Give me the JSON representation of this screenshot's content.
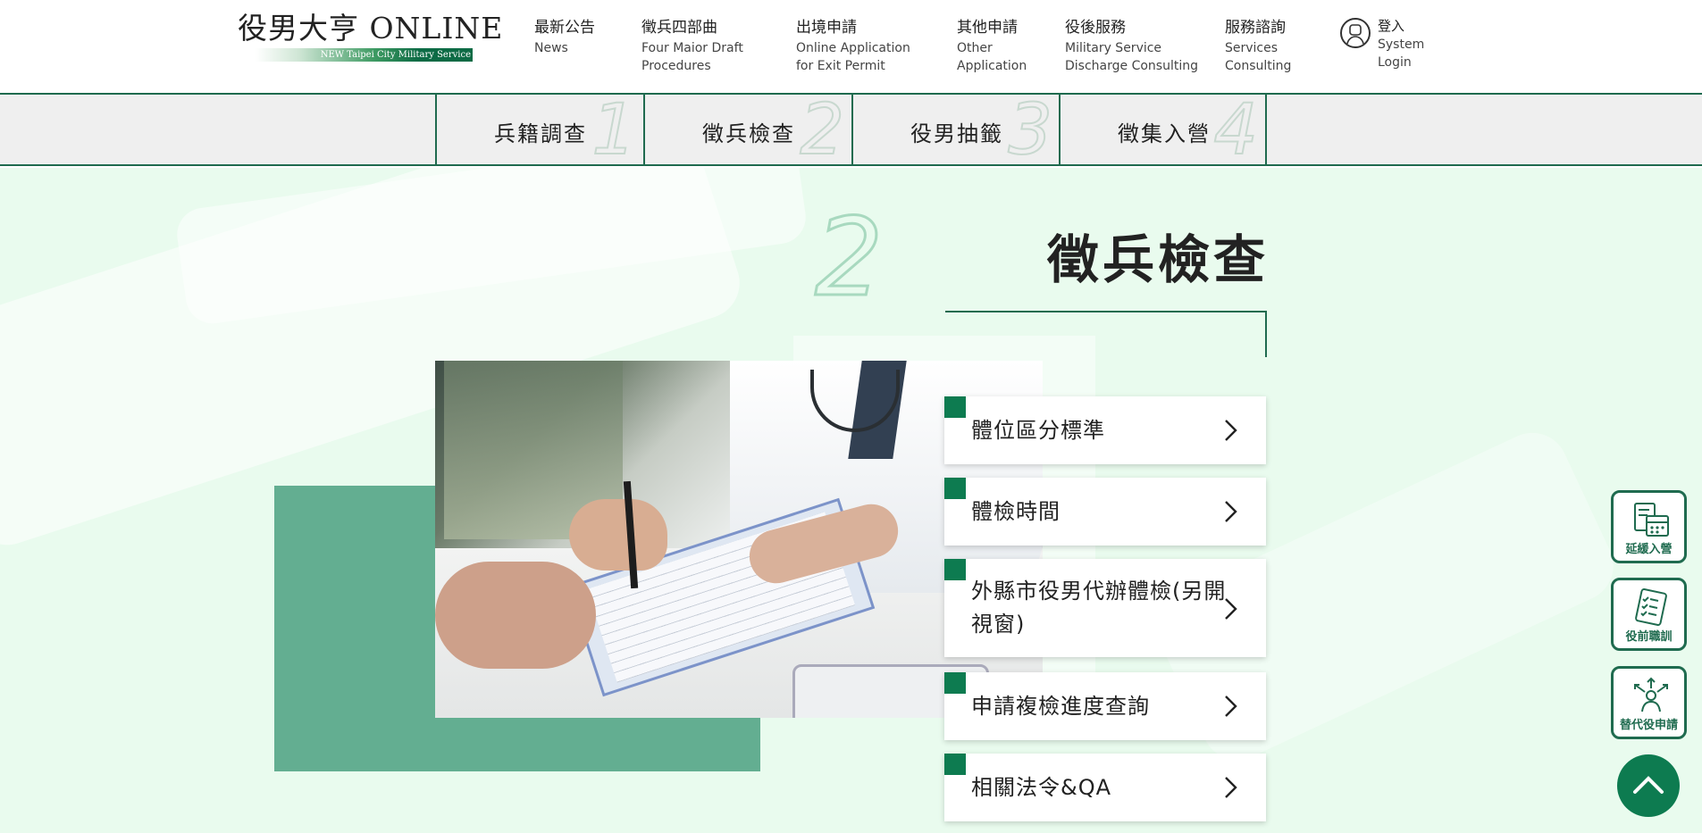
{
  "header": {
    "logo": {
      "title": "役男大亨 ONLINE",
      "subtitle": "NEW Taipei City Military Service"
    },
    "nav": [
      {
        "zh": "最新公告",
        "en": "News"
      },
      {
        "zh": "徵兵四部曲",
        "en": "Four Maior Draft Procedures"
      },
      {
        "zh": "出境申請",
        "en": "Online Application for Exit Permit"
      },
      {
        "zh": "其他申請",
        "en": "Other Application"
      },
      {
        "zh": "役後服務",
        "en": "Military Service Discharge Consulting"
      },
      {
        "zh": "服務諮詢",
        "en": "Services Consulting"
      }
    ],
    "login": {
      "zh": "登入",
      "en": "System Login",
      "icon": "user-icon"
    }
  },
  "steps": [
    {
      "label": "兵籍調查",
      "num": "1"
    },
    {
      "label": "徵兵檢查",
      "num": "2"
    },
    {
      "label": "役男抽籤",
      "num": "3"
    },
    {
      "label": "徵集入營",
      "num": "4"
    }
  ],
  "main": {
    "step_number": "2",
    "title": "徵兵檢查",
    "photo_alt": "doctor-consultation-photo",
    "menu": [
      {
        "label": "體位區分標準"
      },
      {
        "label": "體檢時間"
      },
      {
        "label": "外縣市役男代辦體檢(另開視窗)"
      },
      {
        "label": "申請複檢進度查詢"
      },
      {
        "label": "相關法令&QA"
      }
    ]
  },
  "side_buttons": [
    {
      "label": "延緩入營",
      "icon": "calendar-icon"
    },
    {
      "label": "役前職訓",
      "icon": "checklist-icon"
    },
    {
      "label": "替代役申請",
      "icon": "person-arrows-icon"
    }
  ],
  "back_to_top": {
    "icon": "chevron-up-icon"
  },
  "colors": {
    "brand_green": "#1f6b4f",
    "accent_green": "#0d7b50",
    "block_green": "#63ae91",
    "background_mint": "#e9fbee"
  }
}
